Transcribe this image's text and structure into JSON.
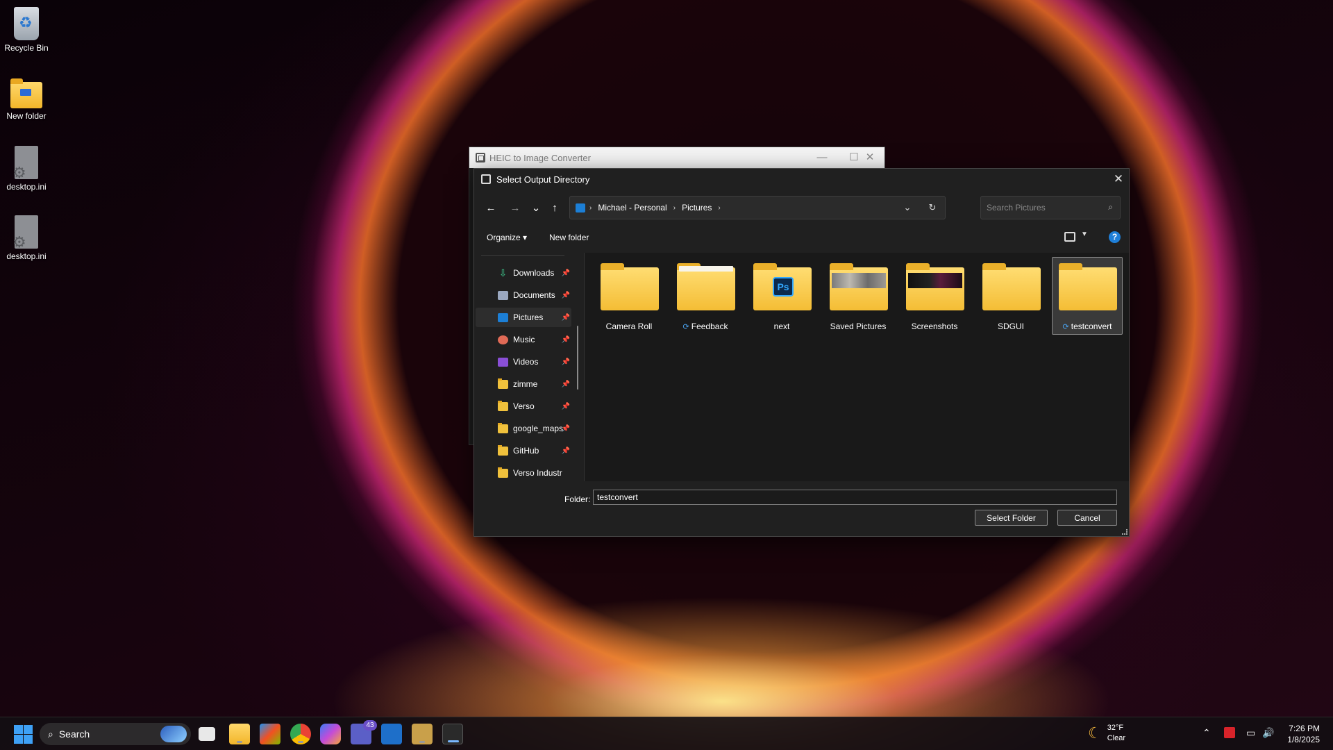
{
  "desktop": {
    "icons": [
      {
        "label": "Recycle Bin",
        "icon": "recycle-bin-icon"
      },
      {
        "label": "New folder",
        "icon": "folder-icon"
      },
      {
        "label": "desktop.ini",
        "icon": "settings-file-icon"
      },
      {
        "label": "desktop.ini",
        "icon": "settings-file-icon"
      }
    ]
  },
  "app_window": {
    "title": "HEIC to Image Converter",
    "controls": {
      "minimize": "—",
      "maximize": "☐",
      "close": "✕"
    }
  },
  "dialog": {
    "title": "Select Output Directory",
    "close": "✕",
    "nav": {
      "back": "←",
      "forward": "→",
      "recent": "⌄",
      "up": "↑"
    },
    "breadcrumb": [
      "Michael - Personal",
      "Pictures"
    ],
    "breadcrumb_sep": "›",
    "refresh": "↻",
    "dropdown": "⌄",
    "search_placeholder": "Search Pictures",
    "organize_label": "Organize ▾",
    "new_folder_label": "New folder",
    "help": "?",
    "sidebar": [
      {
        "label": "Downloads",
        "icon": "downloads-icon"
      },
      {
        "label": "Documents",
        "icon": "documents-icon"
      },
      {
        "label": "Pictures",
        "icon": "pictures-icon",
        "active": true
      },
      {
        "label": "Music",
        "icon": "music-icon"
      },
      {
        "label": "Videos",
        "icon": "videos-icon"
      },
      {
        "label": "zimme",
        "icon": "folder-icon"
      },
      {
        "label": "Verso",
        "icon": "folder-icon"
      },
      {
        "label": "google_maps",
        "icon": "folder-icon"
      },
      {
        "label": "GitHub",
        "icon": "folder-icon"
      },
      {
        "label": "Verso Industr",
        "icon": "folder-icon"
      }
    ],
    "folders": [
      {
        "label": "Camera Roll",
        "sync": false,
        "style": "plain"
      },
      {
        "label": "Feedback",
        "sync": true,
        "style": "white-top"
      },
      {
        "label": "next",
        "sync": false,
        "style": "photoshop"
      },
      {
        "label": "Saved Pictures",
        "sync": false,
        "style": "photo"
      },
      {
        "label": "Screenshots",
        "sync": false,
        "style": "dark"
      },
      {
        "label": "SDGUI",
        "sync": false,
        "style": "plain"
      },
      {
        "label": "testconvert",
        "sync": true,
        "style": "plain",
        "selected": true
      }
    ],
    "folder_field_label": "Folder:",
    "folder_field_value": "testconvert",
    "select_button": "Select Folder",
    "cancel_button": "Cancel"
  },
  "taskbar": {
    "search_label": "Search",
    "teams_badge": "43",
    "weather_temp": "32°F",
    "weather_cond": "Clear",
    "time": "7:26 PM",
    "date": "1/8/2025"
  },
  "colors": {
    "accent": "#1f7fd8",
    "folder": "#f4bd35",
    "dialog_bg": "#202020"
  }
}
